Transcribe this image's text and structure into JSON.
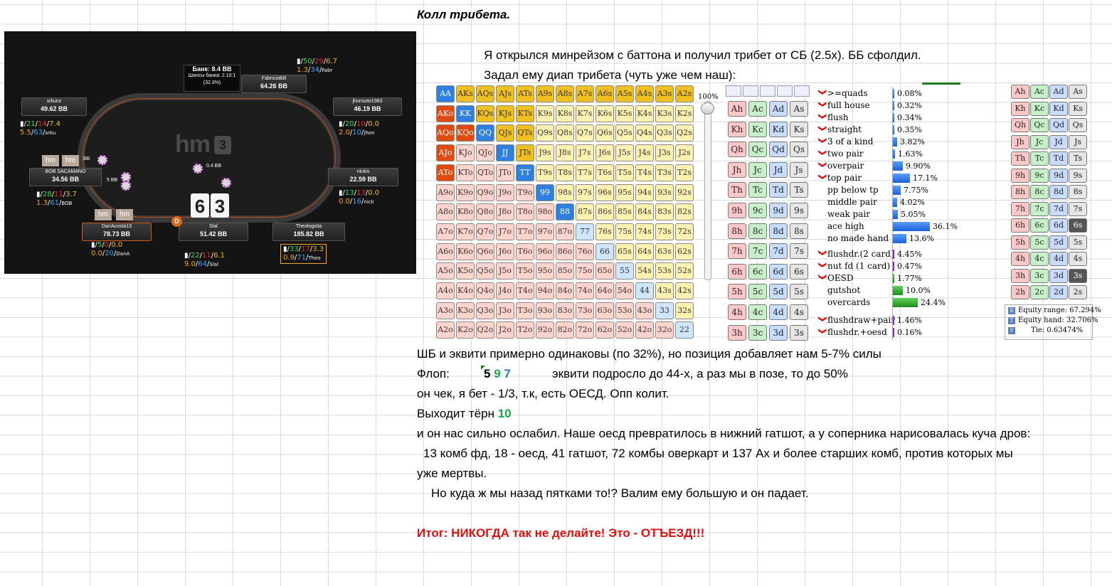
{
  "title": "Колл трибета.",
  "lines": {
    "l1": "Я открылся минрейзом с баттона и получил трибет от СБ (2.5х). ББ сфолдил.",
    "l2": "Задал ему диап трибета (чуть уже чем наш):",
    "l3": "ШБ и эквити примерно одинаковы (по 32%), но позиция добавляет нам 5-7% силы",
    "flop_label": "Флоп:",
    "flop_cards": [
      "5",
      "9",
      "7"
    ],
    "flop_comment": "эквити подросло до 44-х, а раз мы в позе, то до 50%",
    "l5": "он чек, я бет - 1/3, т.к, есть ОЕСД. Опп колит.",
    "turn_label": "Выходит тёрн",
    "turn_card": "10",
    "l7": "и он нас сильно ослабил. Наше оесд превратилось в нижний гатшот, а у соперника нарисовалась куча дров:",
    "l8": "13 комб фд, 18 - оесд, 41 гатшот, 72 комбы оверкарт и 137 Ах и более старших комб, против которых мы",
    "l9": "уже мертвы.",
    "l10": "Но куда ж мы назад пятками то!? Валим ему большую и он падает.",
    "result": "Итог: НИКОГДА так не делайте! Это - ОТЪЕЗД!!!"
  },
  "table": {
    "pot": "Банк: 8.4 BB",
    "pot_odds": "Шансы банка: 2.10:1",
    "pot_pct": "(32.3%)",
    "logo": "hm",
    "hole_cards": [
      "6",
      "3"
    ],
    "bet_small": "0.4 BB",
    "bet_sb": "5 BB",
    "bet_bb_tag": "BB",
    "dealer": "D",
    "seats": [
      {
        "name": "FabricioBill",
        "stack": "64.26 BB",
        "s1": "50",
        "s2": "29",
        "s3": "6.7",
        "t1": "1.3",
        "t2": "34",
        "tag": "Fabr"
      },
      {
        "name": "srkunz",
        "stack": "49.62 BB",
        "s1": "21",
        "s2": "14",
        "s3": "7.4",
        "t1": "5.5",
        "t2": "63",
        "tag": "srku"
      },
      {
        "name": "jhonsoto1983",
        "stack": "46.19 BB",
        "s1": "20",
        "s2": "10",
        "s3": "0.0",
        "t1": "2.0",
        "t2": "10",
        "tag": "jhon"
      },
      {
        "name": "BOB SACAMANO",
        "stack": "34.56 BB",
        "s1": "28",
        "s2": "11",
        "s3": "3.7",
        "t1": "1.3",
        "t2": "61",
        "tag": "BOB"
      },
      {
        "name": "nickis",
        "stack": "22.59 BB",
        "s1": "13",
        "s2": "13",
        "s3": "0.0",
        "t1": "0.0",
        "t2": "16",
        "tag": "nick"
      },
      {
        "name": "DanAcosta13",
        "stack": "78.73 BB",
        "s1": "5",
        "s2": "0",
        "s3": "0.0",
        "t1": "0.0",
        "t2": "20",
        "tag": "DanA"
      },
      {
        "name": "Slal",
        "stack": "51.42 BB",
        "s1": "22",
        "s2": "11",
        "s3": "6.1",
        "t1": "9.0",
        "t2": "64",
        "tag": "Slal"
      },
      {
        "name": "Theologista",
        "stack": "185.82 BB",
        "s1": "33",
        "s2": "17",
        "s3": "3.3",
        "t1": "0.9",
        "t2": "71",
        "tag": "Theo"
      }
    ]
  },
  "matrix": {
    "ranks": [
      "A",
      "K",
      "Q",
      "J",
      "T",
      "9",
      "8",
      "7",
      "6",
      "5",
      "4",
      "3",
      "2"
    ],
    "selected": [
      "AA",
      "AKs",
      "AQs",
      "AJs",
      "ATs",
      "A9s",
      "A8s",
      "A7s",
      "A6s",
      "A5s",
      "A4s",
      "A3s",
      "A2s",
      "AKo",
      "KK",
      "KQs",
      "KJs",
      "KTs",
      "AQo",
      "KQo",
      "QQ",
      "QJs",
      "QTs",
      "AJo",
      "JJ",
      "JTs",
      "ATo",
      "TT",
      "99",
      "88"
    ],
    "slider_pct": "100%",
    "colors": {
      "pair_sel": "#2f7fe0",
      "suited_sel": "#f0c020",
      "offsuit_sel": "#e04a10",
      "pair": "#cfe6ff",
      "suited": "#fff2b0",
      "offsuit": "#ffd4cc"
    }
  },
  "board_suits": {
    "suits": [
      "h",
      "c",
      "d",
      "s"
    ],
    "ranks": [
      "A",
      "K",
      "Q",
      "J",
      "T",
      "9",
      "8",
      "7",
      "6",
      "5",
      "4",
      "3"
    ],
    "colors": {
      "h": "#ffc8c8",
      "c": "#c8f0c8",
      "d": "#c8dcff",
      "s": "#e6e6e6"
    }
  },
  "right_suits": {
    "ranks": [
      "A",
      "K",
      "Q",
      "J",
      "T",
      "9",
      "8",
      "7",
      "6",
      "5",
      "4",
      "3",
      "2"
    ],
    "dead": [
      "6s",
      "3s"
    ]
  },
  "hands": [
    {
      "label": ">=quads",
      "pct": "0.08%",
      "w": 1,
      "chev": true,
      "c": "b"
    },
    {
      "label": "full house",
      "pct": "0.32%",
      "w": 1,
      "chev": true,
      "c": "b"
    },
    {
      "label": "flush",
      "pct": "0.34%",
      "w": 1,
      "chev": true,
      "c": "b"
    },
    {
      "label": "straight",
      "pct": "0.35%",
      "w": 1,
      "chev": true,
      "c": "b"
    },
    {
      "label": "3 of a kind",
      "pct": "3.82%",
      "w": 6,
      "chev": true,
      "c": "b"
    },
    {
      "label": "two pair",
      "pct": "1.63%",
      "w": 3,
      "chev": true,
      "c": "b"
    },
    {
      "label": "overpair",
      "pct": "9.90%",
      "w": 14,
      "chev": true,
      "c": "b"
    },
    {
      "label": "top pair",
      "pct": "17.1%",
      "w": 24,
      "chev": true,
      "c": "b"
    },
    {
      "label": "pp below tp",
      "pct": "7.75%",
      "w": 11,
      "chev": false,
      "c": "b"
    },
    {
      "label": "middle pair",
      "pct": "4.02%",
      "w": 6,
      "chev": false,
      "c": "b"
    },
    {
      "label": "weak pair",
      "pct": "5.05%",
      "w": 7,
      "chev": false,
      "c": "b"
    },
    {
      "label": "ace high",
      "pct": "36.1%",
      "w": 52,
      "chev": false,
      "c": "b"
    },
    {
      "label": "no made hand",
      "pct": "13.6%",
      "w": 19,
      "chev": false,
      "c": "b"
    },
    {
      "label": "flushdr.(2 card)",
      "pct": "4.45%",
      "w": 2,
      "chev": true,
      "c": "p"
    },
    {
      "label": "nut fd (1 card)",
      "pct": "0.47%",
      "w": 1,
      "chev": true,
      "c": "p"
    },
    {
      "label": "OESD",
      "pct": "1.77%",
      "w": 2,
      "chev": true,
      "c": "g"
    },
    {
      "label": "gutshot",
      "pct": "10.0%",
      "w": 14,
      "chev": false,
      "c": "g"
    },
    {
      "label": "overcards",
      "pct": "24.4%",
      "w": 35,
      "chev": false,
      "c": "g"
    },
    {
      "label": "flushdraw+pair",
      "pct": "1.46%",
      "w": 1,
      "chev": true,
      "c": "p"
    },
    {
      "label": "flushdr.+oesd",
      "pct": "0.16%",
      "w": 1,
      "chev": true,
      "c": "p"
    }
  ],
  "equity": {
    "range": "Equity range: 67.294%",
    "hand": "Equity hand: 32.706%",
    "tie": "Tie: 0.63474%",
    "keys": [
      "R",
      "T",
      "F"
    ]
  }
}
